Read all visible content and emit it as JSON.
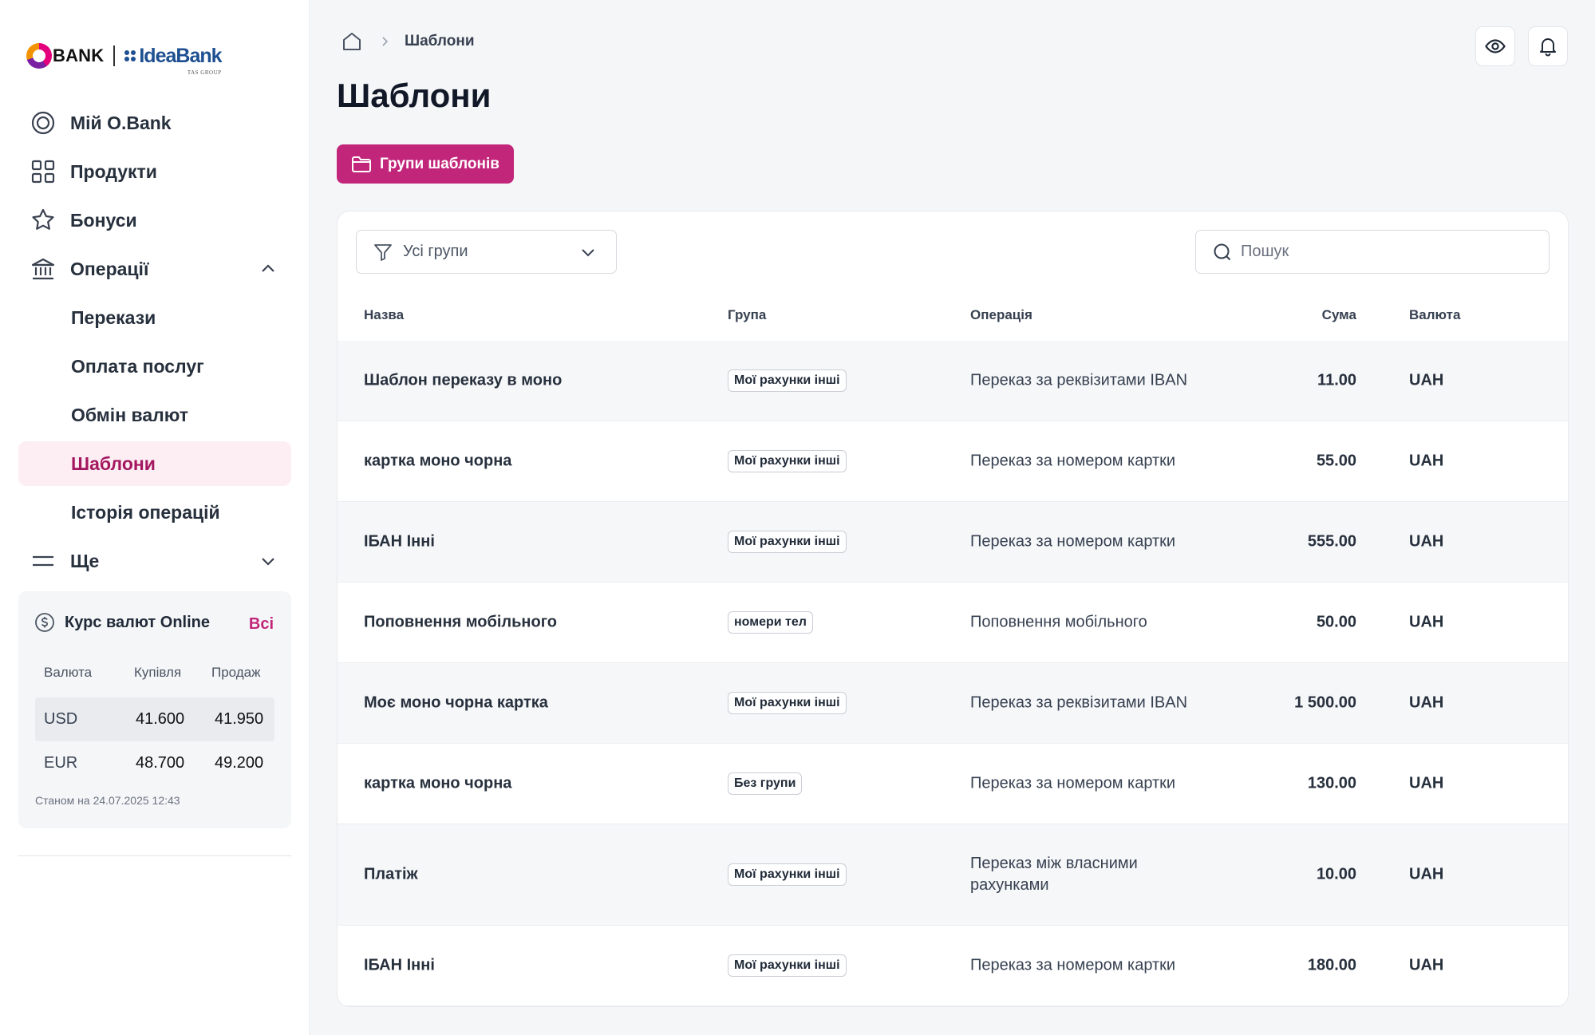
{
  "logo": {
    "obank": "BANK",
    "idea": "IdeaBank",
    "tas": "TAS GROUP"
  },
  "nav": {
    "items": [
      {
        "label": "Мій O.Bank",
        "icon": "target-icon"
      },
      {
        "label": "Продукти",
        "icon": "grid-icon"
      },
      {
        "label": "Бонуси",
        "icon": "star-icon"
      },
      {
        "label": "Операції",
        "icon": "bank-icon"
      }
    ],
    "sub_items": [
      "Перекази",
      "Оплата послуг",
      "Обмін валют",
      "Шаблони",
      "Історія операцій"
    ],
    "more": "Ще"
  },
  "rates": {
    "title": "Курс валют Online",
    "all_link": "Всі",
    "columns": [
      "Валюта",
      "Купівля",
      "Продаж"
    ],
    "rows": [
      {
        "currency": "USD",
        "buy": "41.600",
        "sell": "41.950"
      },
      {
        "currency": "EUR",
        "buy": "48.700",
        "sell": "49.200"
      }
    ],
    "as_of": "Станом на 24.07.2025 12:43"
  },
  "breadcrumb": {
    "current": "Шаблони"
  },
  "page": {
    "title": "Шаблони",
    "groups_button": "Групи шаблонів"
  },
  "filter": {
    "selected": "Усі групи"
  },
  "search": {
    "placeholder": "Пошук",
    "value": ""
  },
  "table": {
    "columns": [
      "Назва",
      "Група",
      "Операція",
      "Сума",
      "Валюта"
    ],
    "rows": [
      {
        "name": "Шаблон переказу в моно",
        "group": "Мої рахунки інші",
        "operation": "Переказ за реквізитами IBAN",
        "sum": "11.00",
        "currency": "UAH"
      },
      {
        "name": "картка моно чорна",
        "group": "Мої рахунки інші",
        "operation": "Переказ за номером картки",
        "sum": "55.00",
        "currency": "UAH"
      },
      {
        "name": "ІБАН Інні",
        "group": "Мої рахунки інші",
        "operation": "Переказ за номером картки",
        "sum": "555.00",
        "currency": "UAH"
      },
      {
        "name": "Поповнення мобільного",
        "group": "номери тел",
        "operation": "Поповнення мобільного",
        "sum": "50.00",
        "currency": "UAH"
      },
      {
        "name": "Моє моно чорна картка",
        "group": "Мої рахунки інші",
        "operation": "Переказ за реквізитами IBAN",
        "sum": "1 500.00",
        "currency": "UAH"
      },
      {
        "name": "картка моно чорна",
        "group": "Без групи",
        "operation": "Переказ за номером картки",
        "sum": "130.00",
        "currency": "UAH"
      },
      {
        "name": "Платіж",
        "group": "Мої рахунки інші",
        "operation": "Переказ між власними рахунками",
        "sum": "10.00",
        "currency": "UAH"
      },
      {
        "name": "ІБАН Інні",
        "group": "Мої рахунки інші",
        "operation": "Переказ за номером картки",
        "sum": "180.00",
        "currency": "UAH"
      }
    ]
  },
  "colors": {
    "accent": "#c2267a",
    "active_bg": "#fdeef4",
    "active_text": "#a3175f"
  }
}
